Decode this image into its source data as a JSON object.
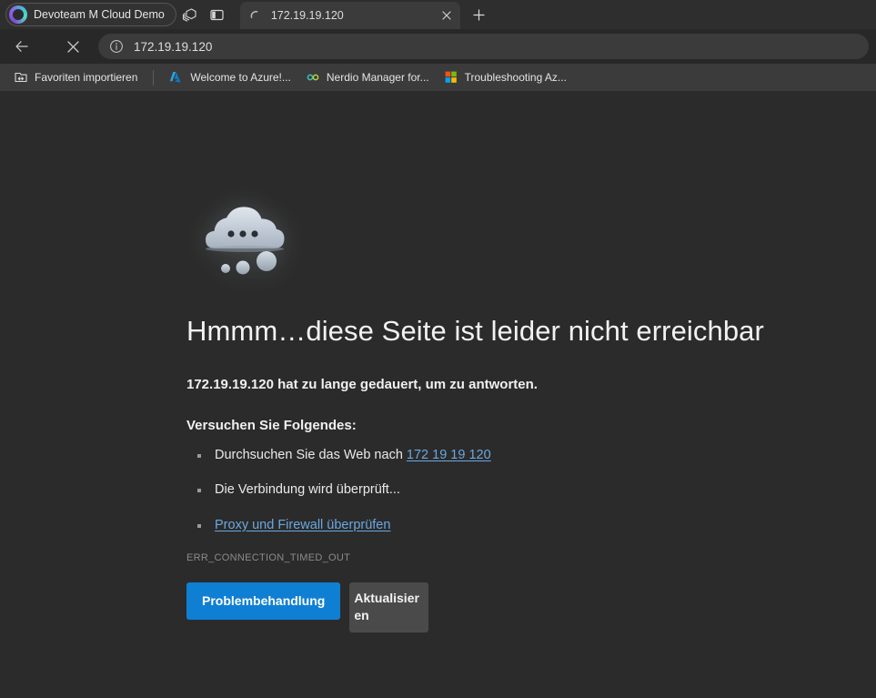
{
  "titlebar": {
    "profile_name": "Devoteam M Cloud Demo",
    "profile_avatar_icon": "account-avatar",
    "tab_collections_icon": "tab-collections-icon",
    "split_screen_icon": "split-screen-icon",
    "tab": {
      "title": "172.19.19.120",
      "loading_icon": "loading-spinner-icon",
      "close_icon": "close-icon"
    },
    "new_tab_icon": "plus-icon"
  },
  "toolbar": {
    "back_icon": "back-arrow-icon",
    "stop_icon": "stop-loading-icon",
    "site_info_icon": "info-circle-icon",
    "url": "172.19.19.120"
  },
  "bookmarks": [
    {
      "label": "Favoriten importieren",
      "icon": "import-favorites-icon"
    },
    {
      "label": "Welcome to Azure!...",
      "icon": "azure-logo-icon"
    },
    {
      "label": "Nerdio Manager for...",
      "icon": "nerdio-logo-icon"
    },
    {
      "label": "Troubleshooting Az...",
      "icon": "microsoft-logo-icon"
    }
  ],
  "error_page": {
    "illustration_icon": "disconnected-cloud-illustration",
    "headline": "Hmmm…diese Seite ist leider nicht erreichbar",
    "subtitle": "172.19.19.120 hat zu lange gedauert, um zu antworten.",
    "suggestions_heading": "Versuchen Sie Folgendes:",
    "suggestions": [
      {
        "text": "Durchsuchen Sie das Web nach ",
        "link": "172 19 19 120"
      },
      {
        "text": "Die Verbindung wird überprüft...",
        "link": ""
      },
      {
        "text": "",
        "link": "Proxy und Firewall überprüfen"
      }
    ],
    "error_code": "ERR_CONNECTION_TIMED_OUT",
    "primary_button": "Problembehandlung",
    "secondary_button": "Aktualisieren"
  },
  "colors": {
    "page_background": "#2b2b2b",
    "titlebar": "#2e2e2e",
    "toolbar": "#282828",
    "bookmarks_bar": "#3b3b3b",
    "accent_blue": "#0f7fd4",
    "link_blue": "#6aa8e0",
    "cloud": "#c3ccd6"
  }
}
